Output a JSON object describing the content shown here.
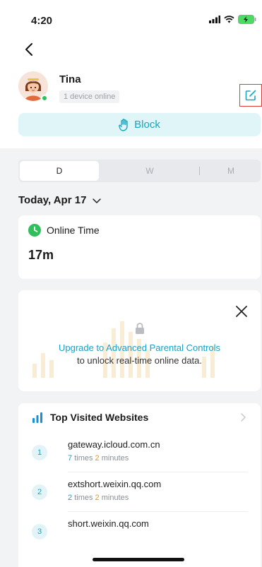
{
  "status_bar": {
    "time": "4:20"
  },
  "header": {
    "name": "Tina",
    "device_status": "1 device online",
    "block_label": "Block"
  },
  "range_tabs": {
    "day": "D",
    "week": "W",
    "month": "M"
  },
  "date_label": "Today, Apr 17",
  "online_card": {
    "title": "Online Time",
    "value": "17m"
  },
  "upgrade_card": {
    "link": "Upgrade to Advanced Parental Controls",
    "subtitle": "to unlock real-time online data."
  },
  "sites": {
    "title": "Top Visited Websites",
    "items": [
      {
        "rank": "1",
        "domain": "gateway.icloud.com.cn",
        "visits": "7",
        "visits_unit": "times",
        "minutes": "2",
        "minutes_unit": "minutes"
      },
      {
        "rank": "2",
        "domain": "extshort.weixin.qq.com",
        "visits": "2",
        "visits_unit": "times",
        "minutes": "2",
        "minutes_unit": "minutes"
      },
      {
        "rank": "3",
        "domain": "short.weixin.qq.com"
      }
    ]
  },
  "colors": {
    "accent": "#17a7c1",
    "accent_bg": "#dff5f8",
    "online_green": "#2fbf5b",
    "highlight_red": "#e53935",
    "minutes_orange": "#e39a1e"
  },
  "icons": [
    "back-arrow-icon",
    "avatar",
    "edit-icon",
    "hand-icon",
    "chevron-down-icon",
    "clock-icon",
    "close-icon",
    "lock-icon",
    "bar-chart-icon",
    "chevron-right-icon"
  ]
}
